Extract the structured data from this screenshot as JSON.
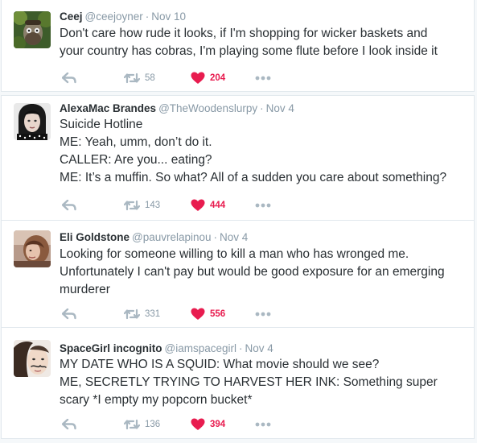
{
  "colors": {
    "like": "#e81c4f",
    "muted": "#8899a6",
    "text": "#292f33",
    "border": "#e1e8ed"
  },
  "icons": {
    "reply": "reply-arrow-icon",
    "retweet": "retweet-icon",
    "like": "heart-icon",
    "more": "more-dots-icon"
  },
  "tweets": [
    {
      "name": "Ceej",
      "handle": "@ceejoyner",
      "separator": "·",
      "date": "Nov 10",
      "lines": [
        "Don't care how rude it looks, if I'm shopping for wicker baskets and",
        "your country has cobras, I'm playing some flute before I look inside it"
      ],
      "retweets": "58",
      "likes": "204"
    },
    {
      "name": "AlexaMac Brandes",
      "handle": "@TheWoodenslurpy",
      "separator": "·",
      "date": "Nov 4",
      "lines": [
        "Suicide Hotline",
        "ME: Yeah, umm, don’t do it.",
        "CALLER: Are you... eating?",
        "ME: It’s a muffin. So what? All of a sudden you care about something?"
      ],
      "retweets": "143",
      "likes": "444"
    },
    {
      "name": "Eli Goldstone",
      "handle": "@pauvrelapinou",
      "separator": "·",
      "date": "Nov 4",
      "lines": [
        "Looking for someone willing to kill a man who has wronged me.",
        "Unfortunately I can't pay but would be good exposure for an emerging",
        "murderer"
      ],
      "retweets": "331",
      "likes": "556"
    },
    {
      "name": "SpaceGirl incognito",
      "handle": "@iamspacegirl",
      "separator": "·",
      "date": "Nov 4",
      "lines": [
        "MY DATE WHO IS A SQUID: What movie should we see?",
        "ME, SECRETLY TRYING TO HARVEST HER INK: Something super",
        "scary *I empty my popcorn bucket*"
      ],
      "retweets": "136",
      "likes": "394"
    }
  ]
}
